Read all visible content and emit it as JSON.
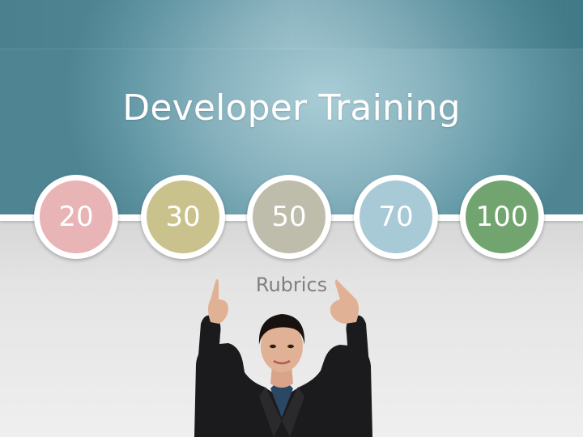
{
  "slide": {
    "title": "Developer Training",
    "subtitle": "Rubrics",
    "scores": [
      {
        "label": "20",
        "color": "#e8b4b6"
      },
      {
        "label": "30",
        "color": "#cac28d"
      },
      {
        "label": "50",
        "color": "#bebcab"
      },
      {
        "label": "70",
        "color": "#a8cad6"
      },
      {
        "label": "100",
        "color": "#72a46f"
      }
    ]
  },
  "colors": {
    "header": "#6fa3b1",
    "background": "#ececec",
    "title_text": "#ffffff",
    "subtitle_text": "#7f7f7f"
  }
}
